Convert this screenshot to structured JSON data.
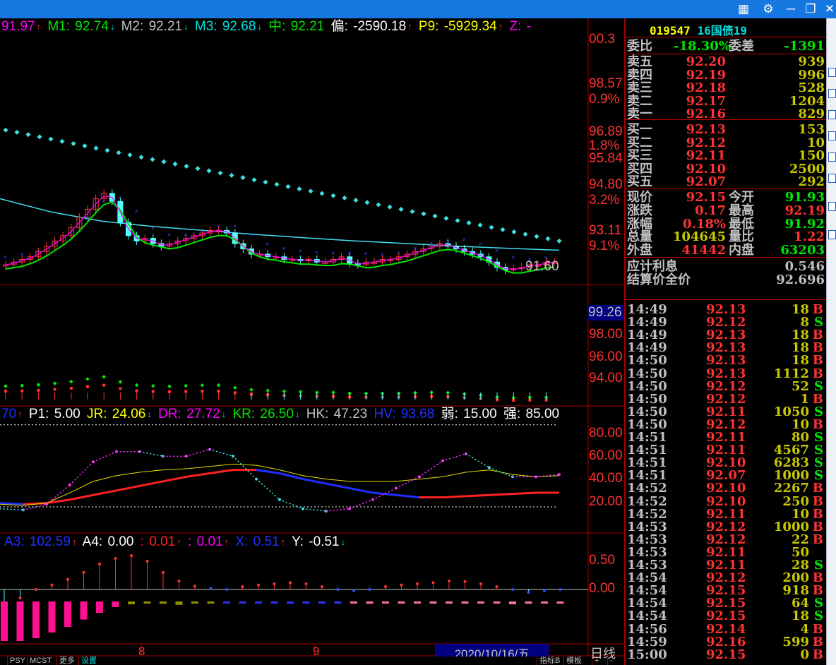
{
  "window": {
    "icons": [
      "grid-icon",
      "gear-icon",
      "minimize-icon",
      "restore-icon",
      "close-icon"
    ]
  },
  "main_header": [
    {
      "label": "",
      "value": "91.97",
      "color": "#ff00ff",
      "arrow": "up"
    },
    {
      "label": "M1: ",
      "value": "92.74",
      "color": "#00e600",
      "arrow": "down"
    },
    {
      "label": "M2: ",
      "value": "92.21",
      "color": "#c0c0c0",
      "arrow": "down"
    },
    {
      "label": "M3: ",
      "value": "92.68",
      "color": "#00e0e0",
      "arrow": "down"
    },
    {
      "label": "中: ",
      "value": "92.21",
      "color": "#00e600",
      "arrow": ""
    },
    {
      "label": "偏: ",
      "value": "-2590.18",
      "color": "#ffffff",
      "arrow": "up"
    },
    {
      "label": "P9: ",
      "value": "-5929.34",
      "color": "#ffff00",
      "arrow": "up"
    },
    {
      "label": "Z: ",
      "value": "-",
      "color": "#ff00ff",
      "arrow": ""
    }
  ],
  "ind_header": [
    {
      "label": "",
      "value": "70",
      "color": "#2030ff",
      "arrow": "up"
    },
    {
      "label": "P1: ",
      "value": "5.00",
      "color": "#ffffff",
      "arrow": ""
    },
    {
      "label": "JR: ",
      "value": "24.06",
      "color": "#ffff00",
      "arrow": "down"
    },
    {
      "label": "DR: ",
      "value": "27.72",
      "color": "#ff00ff",
      "arrow": "down"
    },
    {
      "label": "KR: ",
      "value": "26.50",
      "color": "#00e600",
      "arrow": "down"
    },
    {
      "label": "HK: ",
      "value": "47.23",
      "color": "#c0c0c0",
      "arrow": ""
    },
    {
      "label": "HV: ",
      "value": "93.68",
      "color": "#2030ff",
      "arrow": ""
    },
    {
      "label": "弱: ",
      "value": "15.00",
      "color": "#ffffff",
      "arrow": ""
    },
    {
      "label": "强: ",
      "value": "85.00",
      "color": "#ffffff",
      "arrow": ""
    }
  ],
  "macd_header": [
    {
      "label": "A3: ",
      "value": "102.59",
      "color": "#2030ff",
      "arrow": "up"
    },
    {
      "label": "A4: ",
      "value": "0.00",
      "color": "#ffffff",
      "arrow": ""
    },
    {
      "label": "  : ",
      "value": "0.01",
      "color": "#ff2020",
      "arrow": "up"
    },
    {
      "label": ": ",
      "value": "0.01",
      "color": "#ff00ff",
      "arrow": "up"
    },
    {
      "label": "X: ",
      "value": "0.51",
      "color": "#2030ff",
      "arrow": "up"
    },
    {
      "label": "Y: ",
      "value": "-0.51",
      "color": "#ffffff",
      "arrow": "down"
    }
  ],
  "axis_main": [
    "00.3",
    "98.57",
    "0.9%",
    "96.89",
    "1.8%",
    "95.84",
    "94.80",
    "3.2%",
    "93.11",
    "9.1%"
  ],
  "axis_vol": [
    "99.26",
    "98.00",
    "96.00",
    "94.00"
  ],
  "axis_ind": [
    "80.00",
    "60.00",
    "40.00",
    "20.00"
  ],
  "axis_macd": [
    "0.50",
    "0.00"
  ],
  "last_price_label": "91.60",
  "date_axis": {
    "ticks": [
      "8",
      "9"
    ],
    "cursor_date": "2020/10/16/五",
    "period": "日线"
  },
  "bottom_tabs": [
    "PSY",
    "MCST",
    "更多",
    "设置"
  ],
  "bottom_right": [
    "指标B",
    "模板",
    "+",
    "-"
  ],
  "quote": {
    "code": "019547",
    "name": "16国债19",
    "weibi_label": "委比",
    "weibi": "-18.30%",
    "weicha_label": "委差",
    "weicha": "-1391",
    "asks": [
      {
        "label": "卖五",
        "price": "92.20",
        "vol": "939"
      },
      {
        "label": "卖四",
        "price": "92.19",
        "vol": "996"
      },
      {
        "label": "卖三",
        "price": "92.18",
        "vol": "528"
      },
      {
        "label": "卖二",
        "price": "92.17",
        "vol": "1204"
      },
      {
        "label": "卖一",
        "price": "92.16",
        "vol": "829"
      }
    ],
    "bids": [
      {
        "label": "买一",
        "price": "92.13",
        "vol": "153"
      },
      {
        "label": "买二",
        "price": "92.12",
        "vol": "10"
      },
      {
        "label": "买三",
        "price": "92.11",
        "vol": "150"
      },
      {
        "label": "买四",
        "price": "92.10",
        "vol": "2500"
      },
      {
        "label": "买五",
        "price": "92.07",
        "vol": "292"
      }
    ],
    "stats": [
      {
        "l1": "现价",
        "v1": "92.15",
        "c1": "#ff3232",
        "l2": "今开",
        "v2": "91.93",
        "c2": "#00e600"
      },
      {
        "l1": "涨跌",
        "v1": "0.17",
        "c1": "#ff3232",
        "l2": "最高",
        "v2": "92.19",
        "c2": "#ff3232"
      },
      {
        "l1": "涨幅",
        "v1": "0.18%",
        "c1": "#ff3232",
        "l2": "最低",
        "v2": "91.92",
        "c2": "#00e600"
      },
      {
        "l1": "总量",
        "v1": "104645",
        "c1": "#c8c800",
        "l2": "量比",
        "v2": "1.22",
        "c2": "#ff3232"
      },
      {
        "l1": "外盘",
        "v1": "41442",
        "c1": "#ff3232",
        "l2": "内盘",
        "v2": "63203",
        "c2": "#00e600"
      }
    ],
    "interest_label": "应计利息",
    "interest": "0.546",
    "fullprice_label": "结算价全价",
    "fullprice": "92.696"
  },
  "trades": [
    [
      "14:49",
      "92.13",
      "18",
      "B"
    ],
    [
      "14:49",
      "92.12",
      "8",
      "S"
    ],
    [
      "14:49",
      "92.13",
      "18",
      "B"
    ],
    [
      "14:49",
      "92.13",
      "18",
      "B"
    ],
    [
      "14:50",
      "92.13",
      "18",
      "B"
    ],
    [
      "14:50",
      "92.13",
      "1112",
      "B"
    ],
    [
      "14:50",
      "92.12",
      "52",
      "S"
    ],
    [
      "14:50",
      "92.12",
      "1",
      "B"
    ],
    [
      "14:50",
      "92.11",
      "1050",
      "S"
    ],
    [
      "14:50",
      "92.12",
      "10",
      "B"
    ],
    [
      "14:51",
      "92.11",
      "80",
      "S"
    ],
    [
      "14:51",
      "92.11",
      "4567",
      "S"
    ],
    [
      "14:51",
      "92.10",
      "6283",
      "S"
    ],
    [
      "14:51",
      "92.07",
      "1000",
      "S"
    ],
    [
      "14:52",
      "92.10",
      "2267",
      "B"
    ],
    [
      "14:52",
      "92.10",
      "250",
      "B"
    ],
    [
      "14:52",
      "92.11",
      "10",
      "B"
    ],
    [
      "14:53",
      "92.12",
      "1000",
      "B"
    ],
    [
      "14:53",
      "92.12",
      "22",
      "B"
    ],
    [
      "14:53",
      "92.11",
      "50",
      ""
    ],
    [
      "14:53",
      "92.11",
      "28",
      "S"
    ],
    [
      "14:54",
      "92.12",
      "200",
      "B"
    ],
    [
      "14:54",
      "92.15",
      "918",
      "B"
    ],
    [
      "14:54",
      "92.15",
      "64",
      "S"
    ],
    [
      "14:54",
      "92.15",
      "18",
      "S"
    ],
    [
      "14:56",
      "92.14",
      "4",
      "B"
    ],
    [
      "14:59",
      "92.16",
      "599",
      "B"
    ],
    [
      "15:00",
      "92.15",
      "0",
      "B"
    ]
  ],
  "chart_data": {
    "type": "line",
    "main": {
      "ylim": [
        91.4,
        100.3
      ],
      "closes": [
        91.8,
        91.9,
        92.0,
        92.1,
        92.3,
        92.5,
        92.7,
        92.9,
        93.2,
        93.6,
        93.9,
        94.3,
        94.5,
        94.2,
        93.4,
        92.9,
        92.7,
        92.8,
        92.6,
        92.5,
        92.6,
        92.7,
        92.8,
        92.9,
        93.0,
        93.1,
        93.1,
        93.0,
        92.6,
        92.4,
        92.2,
        92.2,
        92.1,
        92.1,
        92.0,
        92.0,
        91.95,
        92.0,
        91.9,
        91.9,
        92.0,
        92.1,
        91.85,
        91.8,
        91.9,
        91.9,
        92.0,
        92.0,
        92.1,
        92.2,
        92.3,
        92.4,
        92.5,
        92.6,
        92.5,
        92.4,
        92.3,
        92.2,
        92.1,
        91.9,
        91.7,
        91.6,
        91.65,
        91.7,
        91.8,
        91.8,
        91.9,
        91.9
      ],
      "ma_cyan": [
        94.3,
        93.8,
        93.45,
        93.25,
        93.1,
        92.95,
        92.82,
        92.7,
        92.6,
        92.5,
        92.42,
        92.35
      ],
      "resistance_dots": {
        "start": 96.9,
        "end": 92.7,
        "count": 50
      }
    },
    "indicator": {
      "ylim": [
        0,
        100
      ],
      "magenta": [
        14,
        13,
        18,
        35,
        55,
        64,
        64,
        60,
        60,
        66,
        60,
        40,
        22,
        14,
        12,
        14,
        22,
        32,
        42,
        56,
        62,
        50,
        42,
        42,
        44
      ],
      "yellow": [
        18,
        17,
        19,
        28,
        38,
        43,
        46,
        48,
        49,
        51,
        53,
        52,
        48,
        43,
        40,
        38,
        38,
        38,
        40,
        42,
        46,
        48,
        44,
        42,
        43
      ],
      "thick": [
        19,
        18,
        19,
        22,
        26,
        30,
        34,
        38,
        42,
        45,
        48,
        48,
        45,
        40,
        36,
        32,
        28,
        26,
        24,
        24,
        25,
        26,
        27,
        28,
        28
      ]
    },
    "macd": {
      "lollipops": [
        -0.3,
        -0.15,
        0.0,
        0.08,
        0.18,
        0.3,
        0.45,
        0.55,
        0.6,
        0.5,
        0.3,
        0.15,
        0.06,
        0.02,
        0.0,
        0.05,
        0.08,
        0.1,
        0.12,
        0.1,
        0.05,
        0.0,
        -0.02,
        0.0,
        0.05,
        0.08,
        0.1,
        0.12,
        0.15,
        0.14,
        0.1,
        0.05,
        0.0,
        -0.05,
        -0.02,
        0.0
      ],
      "hist": [
        -0.7,
        -0.7,
        -0.65,
        -0.55,
        -0.45,
        -0.32,
        -0.2,
        -0.1,
        -0.05,
        -0.03,
        -0.04,
        -0.06,
        -0.03,
        -0.02,
        -0.02,
        0.0,
        -0.02,
        -0.03,
        -0.04,
        -0.03,
        -0.02,
        -0.02,
        -0.03,
        -0.04,
        -0.03,
        -0.02,
        0.0,
        0.02,
        0.03,
        0.02,
        0.0,
        -0.03,
        -0.05,
        -0.04,
        -0.03,
        -0.03
      ]
    }
  }
}
